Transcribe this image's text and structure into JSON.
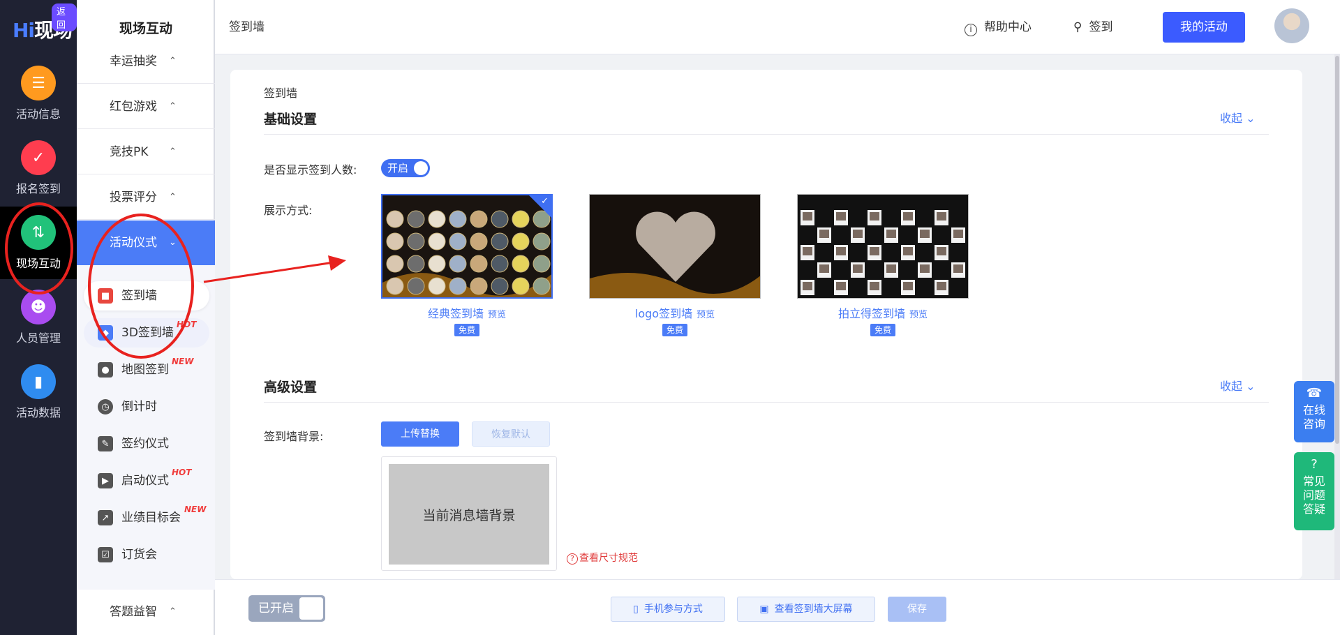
{
  "rail": {
    "logo_hi": "Hi",
    "logo_text": "现场",
    "back": "返回",
    "items": [
      {
        "label": "活动信息",
        "color": "#ff9a1f"
      },
      {
        "label": "报名签到",
        "color": "#ff3d4f"
      },
      {
        "label": "现场互动",
        "color": "#21c27a"
      },
      {
        "label": "人员管理",
        "color": "#a94cf0"
      },
      {
        "label": "活动数据",
        "color": "#2f8cf0"
      }
    ]
  },
  "submenu": {
    "title": "现场互动",
    "groups": [
      {
        "label": "幸运抽奖"
      },
      {
        "label": "红包游戏"
      },
      {
        "label": "竞技PK"
      },
      {
        "label": "投票评分"
      },
      {
        "label": "活动仪式"
      }
    ],
    "items": [
      {
        "label": "签到墙",
        "tag": ""
      },
      {
        "label": "3D签到墙",
        "tag": "HOT"
      },
      {
        "label": "地图签到",
        "tag": "NEW"
      },
      {
        "label": "倒计时",
        "tag": ""
      },
      {
        "label": "签约仪式",
        "tag": ""
      },
      {
        "label": "启动仪式",
        "tag": "HOT"
      },
      {
        "label": "业绩目标会",
        "tag": "NEW"
      },
      {
        "label": "订货会",
        "tag": ""
      }
    ],
    "bottom_group": "答题益智"
  },
  "header": {
    "breadcrumb": "签到墙",
    "help": "帮助中心",
    "checkin": "签到",
    "my_activity": "我的活动"
  },
  "content": {
    "crumb": "签到墙",
    "basic_title": "基础设置",
    "collapse": "收起",
    "show_count_label": "是否显示签到人数:",
    "toggle_on": "开启",
    "display_label": "展示方式:",
    "themes": [
      {
        "name": "经典签到墙",
        "preview": "预览",
        "badge": "免费"
      },
      {
        "name": "logo签到墙",
        "preview": "预览",
        "badge": "免费"
      },
      {
        "name": "拍立得签到墙",
        "preview": "预览",
        "badge": "免费"
      }
    ],
    "advanced_title": "高级设置",
    "bg_label": "签到墙背景:",
    "upload": "上传替换",
    "reset": "恢复默认",
    "bg_placeholder": "当前消息墙背景",
    "size_link": "查看尺寸规范"
  },
  "bottom": {
    "enabled": "已开启",
    "mobile": "手机参与方式",
    "big_screen": "查看签到墙大屏幕",
    "save": "保存"
  },
  "float": {
    "consult": "在线咨询",
    "faq": "常见问题答疑"
  }
}
